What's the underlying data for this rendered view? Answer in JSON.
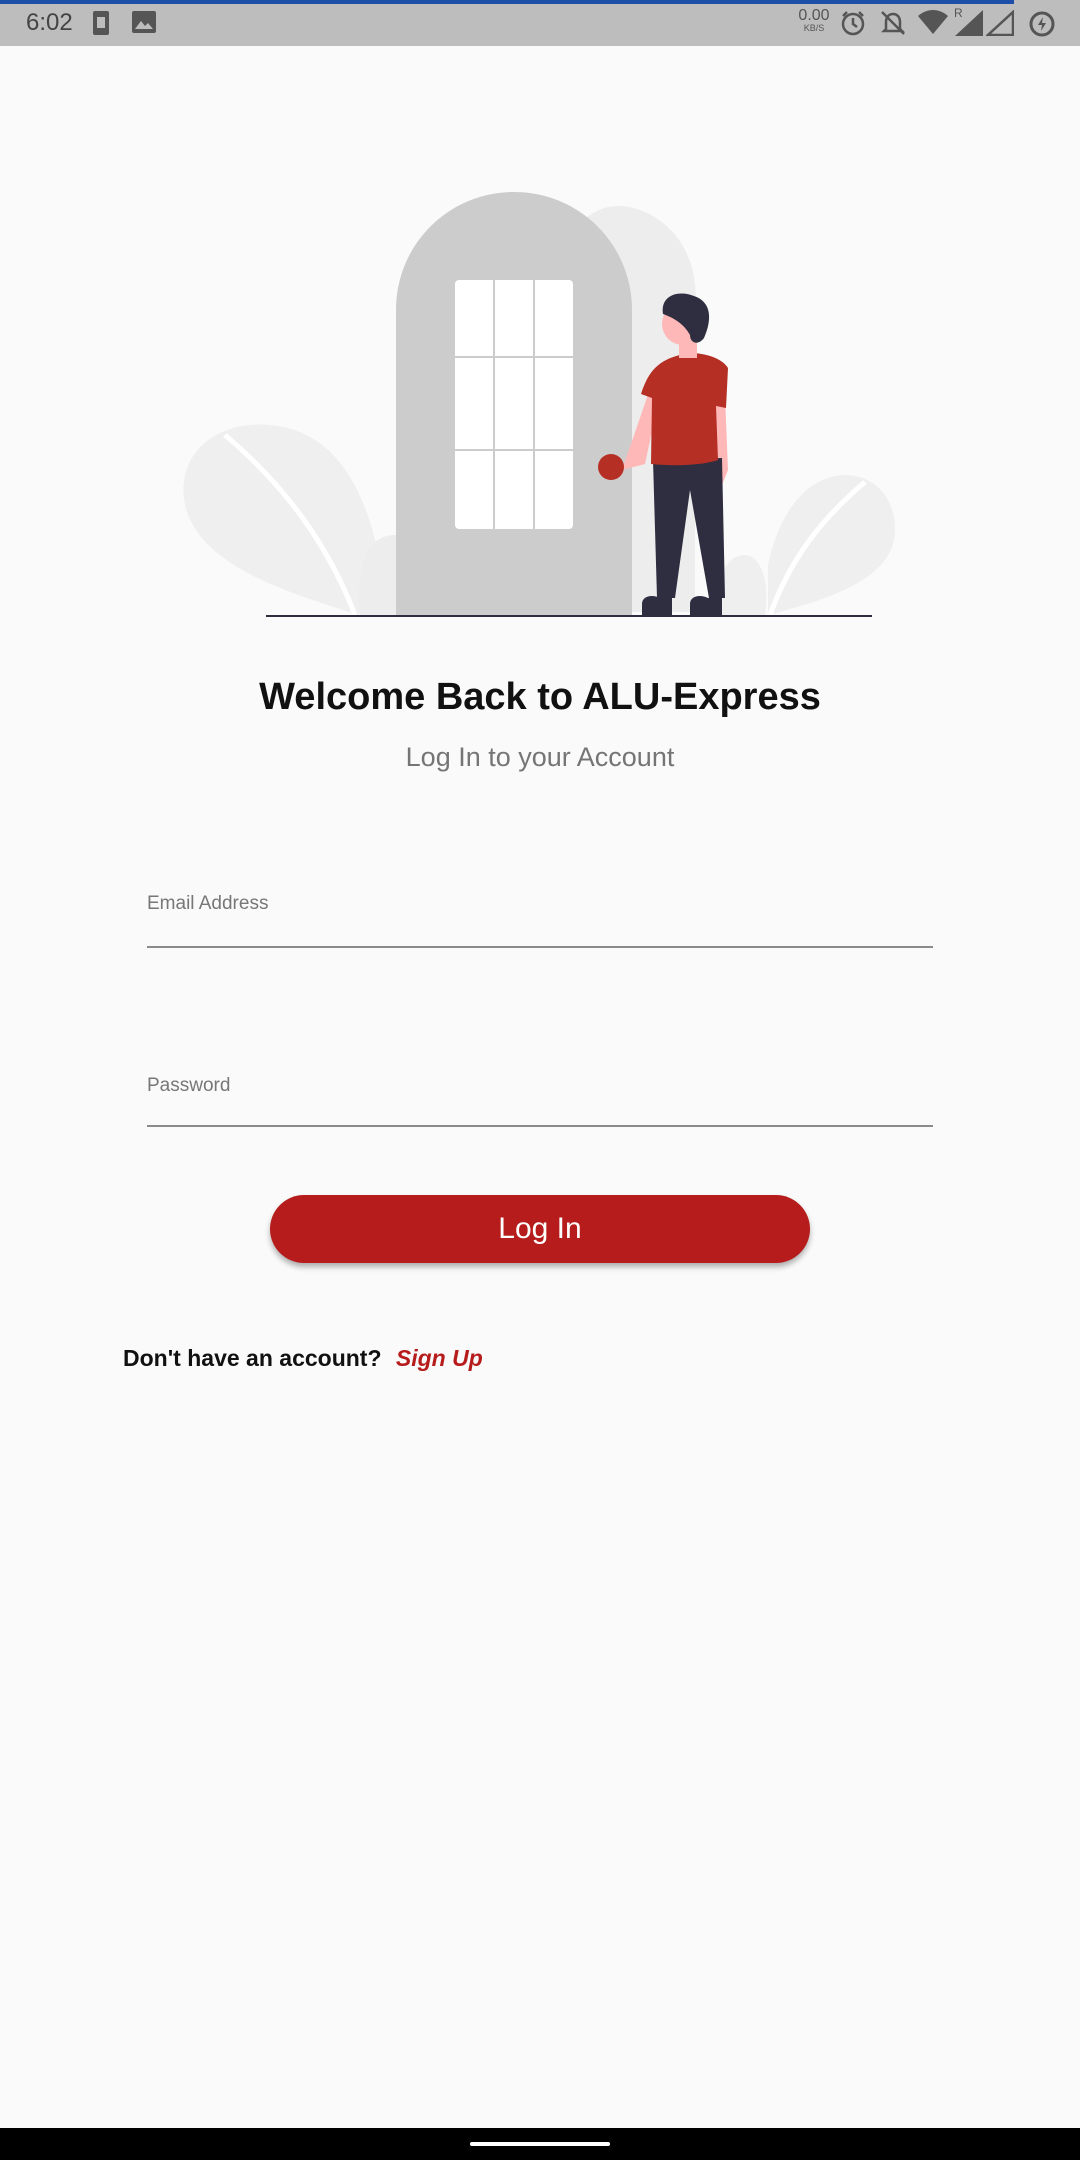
{
  "status_bar": {
    "time": "6:02",
    "net_speed_value": "0.00",
    "net_speed_unit": "KB/S",
    "roaming_indicator": "R",
    "icons": [
      "sim-card-icon",
      "image-icon",
      "alarm-icon",
      "notifications-off-icon",
      "wifi-icon",
      "signal-icon",
      "signal-empty-icon",
      "battery-saver-icon"
    ]
  },
  "header": {
    "title": "Welcome Back to ALU-Express",
    "subtitle": "Log In to your Account"
  },
  "form": {
    "email_label": "Email Address",
    "email_value": "",
    "password_label": "Password",
    "password_value": "",
    "login_button_label": "Log In"
  },
  "footer": {
    "prompt": "Don't have an account?",
    "signup_link": "Sign Up"
  },
  "colors": {
    "primary": "#b71c1c",
    "background": "#fafafa",
    "status_bar": "#bdbdbd",
    "illustration_door": "#cccccc",
    "illustration_shirt": "#b52f24",
    "illustration_pants": "#2f2e41"
  }
}
